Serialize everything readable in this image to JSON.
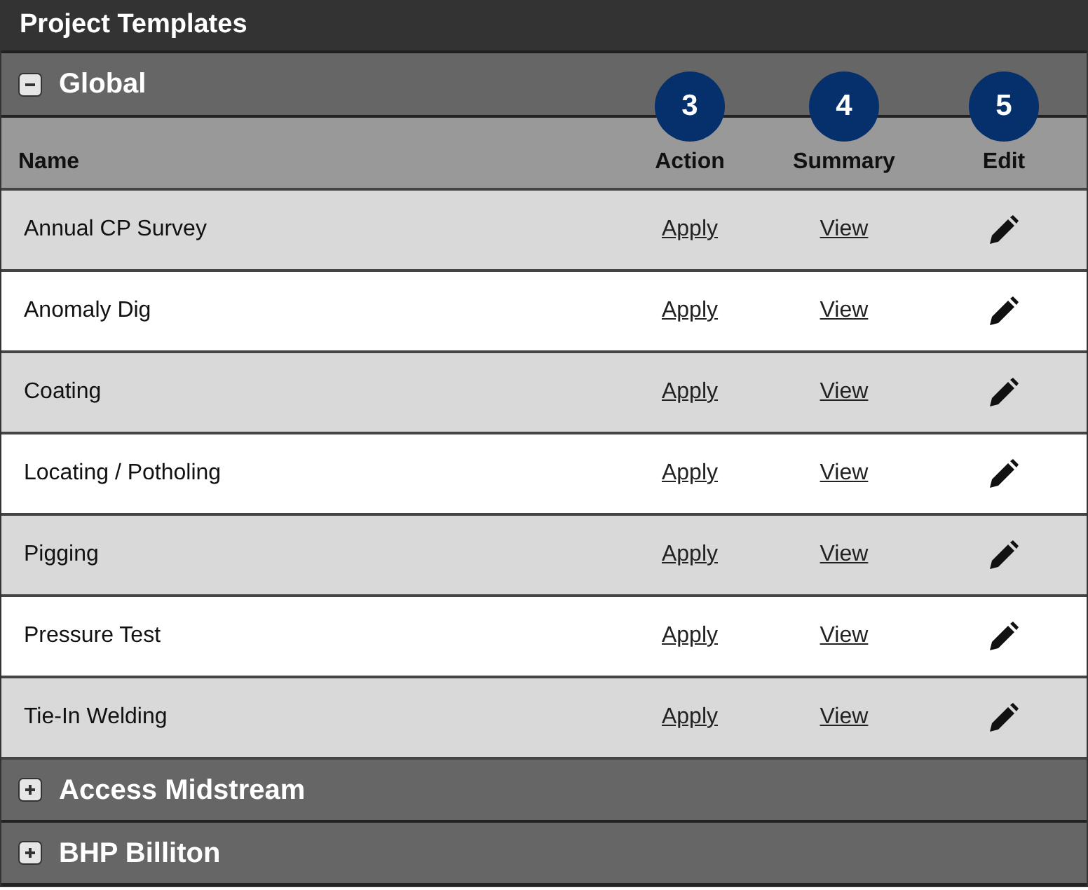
{
  "window": {
    "title": "Project Templates"
  },
  "groups": [
    {
      "name": "Global",
      "expanded": true,
      "columns": [
        {
          "label": "Name"
        },
        {
          "label": "Action",
          "badge": "3"
        },
        {
          "label": "Summary",
          "badge": "4"
        },
        {
          "label": "Edit",
          "badge": "5"
        }
      ],
      "rows": [
        {
          "name": "Annual CP Survey",
          "action": "Apply",
          "summary": "View"
        },
        {
          "name": "Anomaly Dig",
          "action": "Apply",
          "summary": "View"
        },
        {
          "name": "Coating",
          "action": "Apply",
          "summary": "View"
        },
        {
          "name": "Locating / Potholing",
          "action": "Apply",
          "summary": "View"
        },
        {
          "name": "Pigging",
          "action": "Apply",
          "summary": "View"
        },
        {
          "name": "Pressure Test",
          "action": "Apply",
          "summary": "View"
        },
        {
          "name": "Tie-In Welding",
          "action": "Apply",
          "summary": "View"
        }
      ]
    },
    {
      "name": "Access Midstream",
      "expanded": false
    },
    {
      "name": "BHP Billiton",
      "expanded": false
    }
  ]
}
